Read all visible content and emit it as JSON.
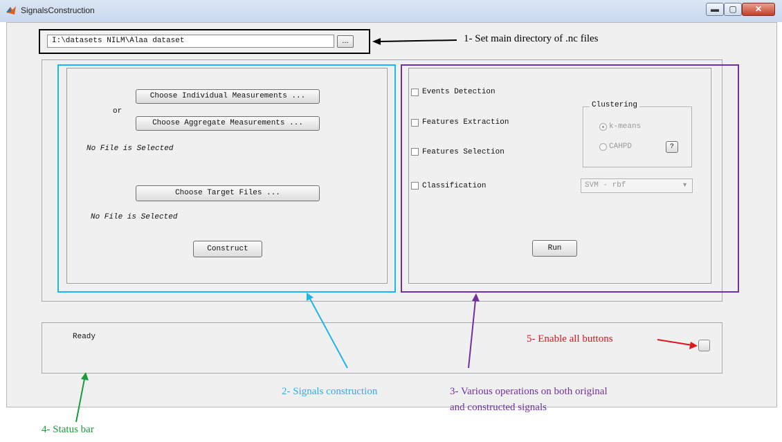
{
  "window": {
    "title": "SignalsConstruction",
    "minimize_label": "▬",
    "maximize_label": "▢",
    "close_label": "✕"
  },
  "directory": {
    "value": "I:\\datasets NILM\\Alaa dataset",
    "browse_label": "..."
  },
  "construction": {
    "individual_label": "Choose Individual Measurements ...",
    "or_label": "or",
    "aggregate_label": "Choose Aggregate Measurements ...",
    "measurements_status": "No File is Selected",
    "target_label": "Choose Target Files ...",
    "target_status": "No File is Selected",
    "construct_label": "Construct"
  },
  "operations": {
    "events_detection": "Events Detection",
    "features_extraction": "Features Extraction",
    "features_selection": "Features Selection",
    "classification": "Classification",
    "clustering": {
      "title": "Clustering",
      "kmeans": "k-means",
      "cahpd": "CAHPD",
      "help_label": "?"
    },
    "classifier_selected": "SVM - rbf",
    "run_label": "Run"
  },
  "status": {
    "text": "Ready"
  },
  "annotations": {
    "a1": "1- Set main directory of .nc files",
    "a2": "2- Signals construction",
    "a3_line1": "3- Various operations on both original",
    "a3_line2": "and constructed signals",
    "a4": "4- Status bar",
    "a5": "5- Enable all buttons"
  },
  "colors": {
    "directory_box": "#000000",
    "construction_box": "#1fb4ea",
    "operations_box": "#7030a0",
    "status_arrow": "#1a9b3c",
    "enable_arrow": "#e0151b"
  }
}
